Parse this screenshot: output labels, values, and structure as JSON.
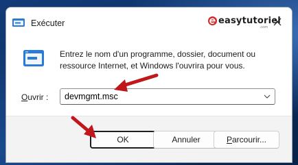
{
  "window": {
    "title": "Exécuter"
  },
  "brand": {
    "text": "easytutoriel",
    "sub": ".com",
    "accent": "#d62828"
  },
  "dialog": {
    "description": "Entrez le nom d'un programme, dossier, document ou ressource Internet, et Windows l'ouvrira pour vous.",
    "open_label_mnemonic": "O",
    "open_label_rest": "uvrir :",
    "open_value": "devmgmt.msc"
  },
  "buttons": {
    "ok": "OK",
    "cancel": "Annuler",
    "browse_mnemonic": "P",
    "browse_rest": "arcourir..."
  },
  "colors": {
    "annotation_arrow": "#c0171c",
    "focus_border": "#1f1f1f"
  },
  "icons": {
    "app": "run-icon",
    "close": "close-icon",
    "dropdown": "chevron-down-icon"
  }
}
